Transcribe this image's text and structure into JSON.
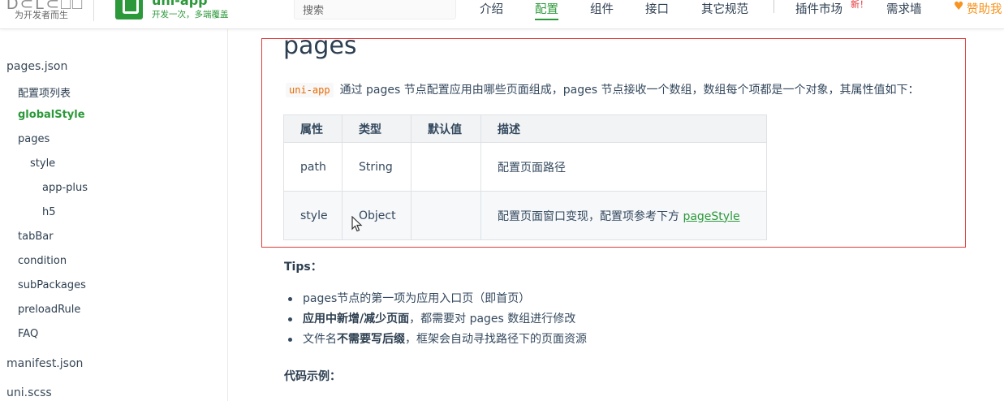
{
  "header": {
    "brand_slogan": "为开发者而生",
    "uni_name": "uni-app",
    "uni_tagline": "开发一次，多端覆盖",
    "search_placeholder": "搜索",
    "nav": [
      "介绍",
      "配置",
      "组件",
      "接口",
      "其它规范",
      "插件市场",
      "需求墙"
    ],
    "nav_active": "配置",
    "new_badge": "新！",
    "sponsor_label": "赞助我",
    "accent_color": "#2b9939"
  },
  "sidebar": {
    "items": [
      {
        "label": "pages.json",
        "level": 0
      },
      {
        "label": "配置项列表",
        "level": 1
      },
      {
        "label": "globalStyle",
        "level": 1,
        "active": true
      },
      {
        "label": "pages",
        "level": 1
      },
      {
        "label": "style",
        "level": 2
      },
      {
        "label": "app-plus",
        "level": 3
      },
      {
        "label": "h5",
        "level": 3
      },
      {
        "label": "tabBar",
        "level": 1
      },
      {
        "label": "condition",
        "level": 1
      },
      {
        "label": "subPackages",
        "level": 1
      },
      {
        "label": "preloadRule",
        "level": 1
      },
      {
        "label": "FAQ",
        "level": 1
      },
      {
        "label": "manifest.json",
        "level": 0
      },
      {
        "label": "uni.scss",
        "level": 0
      }
    ]
  },
  "content": {
    "title": "pages",
    "intro_code": "uni-app",
    "intro_text": "通过 pages 节点配置应用由哪些页面组成，pages 节点接收一个数组，数组每个项都是一个对象，其属性值如下：",
    "table": {
      "headers": [
        "属性",
        "类型",
        "默认值",
        "描述"
      ],
      "rows": [
        {
          "name": "path",
          "type": "String",
          "default": "",
          "desc": "配置页面路径",
          "link": ""
        },
        {
          "name": "style",
          "type": "Object",
          "default": "",
          "desc": "配置页面窗口变现，配置项参考下方 ",
          "link": "pageStyle"
        }
      ]
    },
    "tips_title": "Tips：",
    "tips": [
      {
        "pre": "pages节点的第一项为应用入口页（即首页）",
        "bold": "",
        "post": ""
      },
      {
        "pre": "",
        "bold": "应用中新增/减少页面",
        "post": "，都需要对 pages 数组进行修改"
      },
      {
        "pre": "文件名",
        "bold": "不需要写后缀",
        "post": "，框架会自动寻找路径下的页面资源"
      }
    ],
    "code_title": "代码示例：",
    "highlight_color": "#e03c3c"
  }
}
